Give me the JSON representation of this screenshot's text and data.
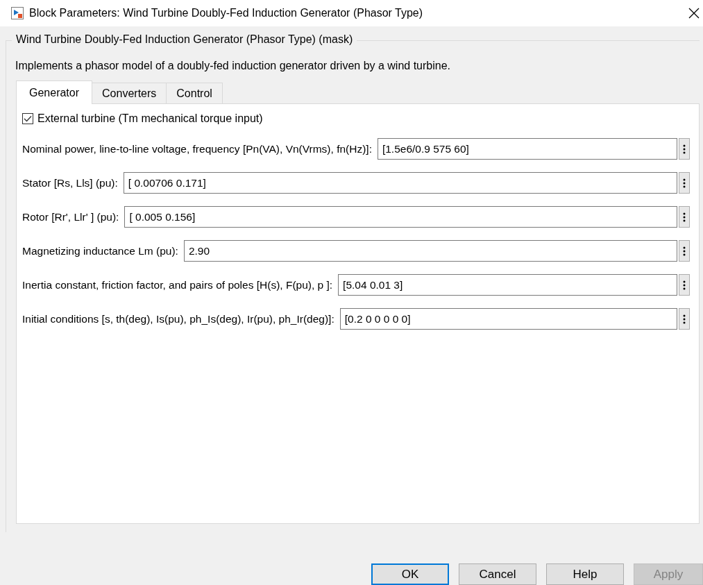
{
  "window": {
    "title": "Block Parameters: Wind Turbine Doubly-Fed Induction Generator (Phasor Type)"
  },
  "group": {
    "title": "Wind Turbine Doubly-Fed Induction Generator (Phasor Type) (mask)",
    "description": "Implements a phasor model of a doubly-fed induction generator driven by a wind turbine."
  },
  "tabs": [
    {
      "label": "Generator",
      "selected": true
    },
    {
      "label": "Converters",
      "selected": false
    },
    {
      "label": "Control",
      "selected": false
    }
  ],
  "checkbox": {
    "label": "External turbine (Tm mechanical torque input)",
    "checked": true
  },
  "parameters": [
    {
      "label": "Nominal power, line-to-line voltage, frequency [Pn(VA), Vn(Vrms), fn(Hz)]:",
      "value": "[1.5e6/0.9 575 60]"
    },
    {
      "label": "Stator [Rs, Lls] (pu):",
      "value": "[ 0.00706 0.171]"
    },
    {
      "label": "Rotor [Rr', Llr' ] (pu):",
      "value": "[ 0.005 0.156]"
    },
    {
      "label": "Magnetizing inductance Lm (pu):",
      "value": "2.90"
    },
    {
      "label": "Inertia constant, friction factor, and pairs of poles [H(s), F(pu),  p ]:",
      "value": "[5.04 0.01 3]"
    },
    {
      "label": "Initial conditions [s,  th(deg),  Is(pu), ph_Is(deg),  Ir(pu),  ph_Ir(deg)]:",
      "value": "[0.2 0 0 0 0 0]"
    }
  ],
  "buttons": [
    {
      "label": "OK",
      "default": true,
      "disabled": false
    },
    {
      "label": "Cancel",
      "default": false,
      "disabled": false
    },
    {
      "label": "Help",
      "default": false,
      "disabled": false
    },
    {
      "label": "Apply",
      "default": false,
      "disabled": true
    }
  ]
}
